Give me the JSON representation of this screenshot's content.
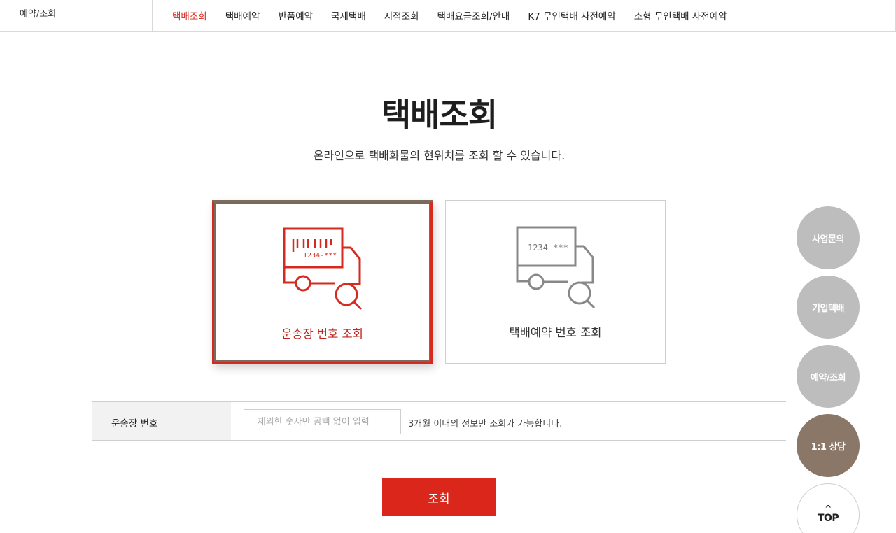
{
  "topbar": {
    "breadcrumb": "예약/조회",
    "nav": [
      "택배조회",
      "택배예약",
      "반품예약",
      "국제택배",
      "지점조회",
      "택배요금조회/안내",
      "K7 무인택배 사전예약",
      "소형 무인택배 사전예약"
    ],
    "active_index": 0
  },
  "page": {
    "title": "택배조회",
    "subtitle": "온라인으로 택배화물의 현위치를 조회 할 수 있습니다."
  },
  "cards": [
    {
      "label": "운송장 번호 조회",
      "icon": "truck-barcode-search-icon",
      "number_text": "1234-***",
      "selected": true
    },
    {
      "label": "택배예약 번호 조회",
      "icon": "truck-number-search-icon",
      "number_text": "1234-***",
      "selected": false
    }
  ],
  "form": {
    "field_label": "운송장 번호",
    "placeholder": "-제외한 숫자만 공백 없이 입력",
    "value": "",
    "note": "3개월 이내의 정보만 조회가 가능합니다."
  },
  "submit_label": "조회",
  "floating": {
    "items": [
      "사업문의",
      "기업택배",
      "예약/조회",
      "1:1 상담"
    ],
    "top_label": "TOP",
    "top_arrow": "^"
  },
  "colors": {
    "accent": "#db261c",
    "brown": "#8a7768",
    "gray_button": "#bdbdbd"
  }
}
